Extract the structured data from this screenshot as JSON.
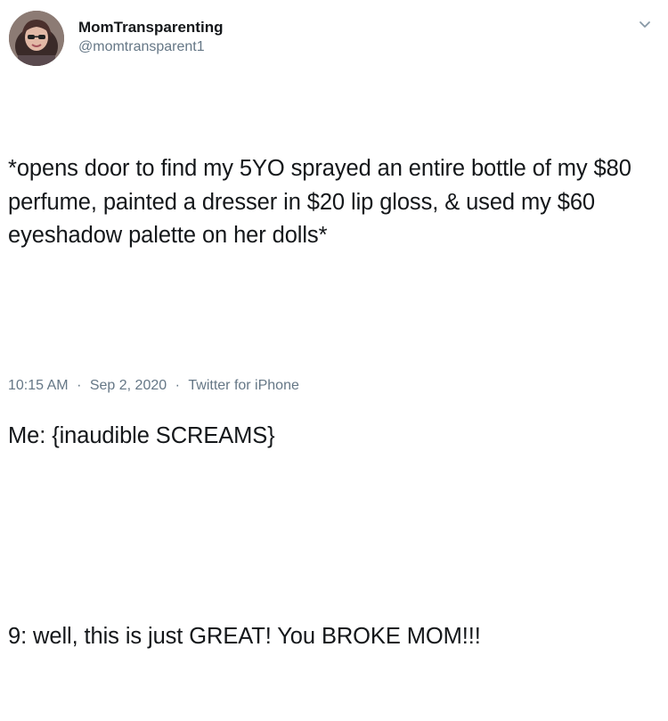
{
  "author": {
    "display_name": "MomTransparenting",
    "handle": "@momtransparent1"
  },
  "tweet": {
    "paragraph_1": "*opens door to find my 5YO sprayed an entire bottle of my $80 perfume, painted a dresser in $20 lip gloss, & used my $60 eyeshadow palette on her dolls*",
    "paragraph_2": "Me: {inaudible SCREAMS}",
    "paragraph_3": "9: well, this is just GREAT! You BROKE MOM!!!"
  },
  "meta": {
    "time": "10:15 AM",
    "separator": "·",
    "date": "Sep 2, 2020",
    "source": "Twitter for iPhone"
  },
  "icons": {
    "avatar": "profile-photo",
    "menu": "chevron-down-icon"
  },
  "colors": {
    "text": "#14171a",
    "secondary": "#657786",
    "background": "#ffffff"
  }
}
